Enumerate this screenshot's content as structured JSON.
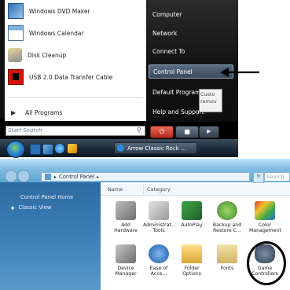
{
  "start_menu": {
    "programs": [
      {
        "label": "Windows DVD Maker",
        "icon": "dvd-maker-icon"
      },
      {
        "label": "Windows Calendar",
        "icon": "calendar-icon"
      },
      {
        "label": "Disk Cleanup",
        "icon": "disk-cleanup-icon"
      },
      {
        "label": "USB 2.0 Data Transfer Cable",
        "icon": "usb-cable-icon"
      }
    ],
    "all_programs": "All Programs",
    "search_placeholder": "Start Search",
    "right_items": [
      "Computer",
      "Network",
      "Connect To",
      "Control Panel",
      "Default Programs",
      "Help and Support"
    ],
    "tooltip": "Custo remov"
  },
  "taskbar": {
    "task_label": "Arrow Classic Rock ..."
  },
  "explorer": {
    "address": "Control Panel",
    "search_placeholder": "Search",
    "sidebar": {
      "home": "Control Panel Home",
      "classic": "Classic View"
    },
    "columns": [
      "Name",
      "Category"
    ],
    "items": [
      {
        "label": "Add Hardware",
        "icon": "add-hardware-icon"
      },
      {
        "label": "Administrat... Tools",
        "icon": "admin-tools-icon"
      },
      {
        "label": "AutoPlay",
        "icon": "autoplay-icon"
      },
      {
        "label": "Backup and Restore C...",
        "icon": "backup-icon"
      },
      {
        "label": "Color Management",
        "icon": "color-management-icon"
      },
      {
        "label": "Device Manager",
        "icon": "device-manager-icon"
      },
      {
        "label": "Ease of Acce...",
        "icon": "ease-of-access-icon"
      },
      {
        "label": "Folder Options",
        "icon": "folder-options-icon"
      },
      {
        "label": "Fonts",
        "icon": "fonts-icon"
      },
      {
        "label": "Game Controllers",
        "icon": "game-controllers-icon"
      }
    ]
  },
  "colors": {
    "accent": "#3d7fb6",
    "taskbar": "#1c2a37",
    "annotation": "#000000"
  }
}
